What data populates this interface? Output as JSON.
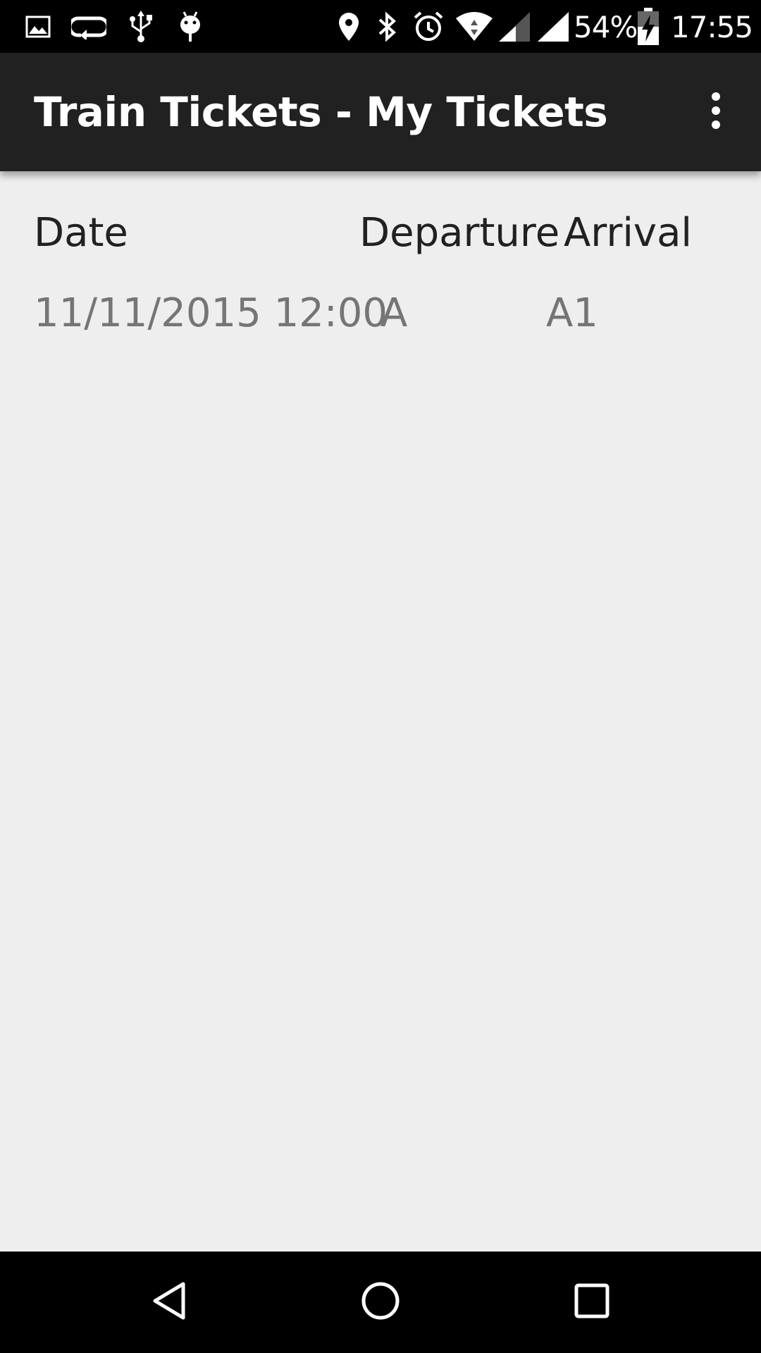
{
  "status_bar": {
    "battery_percent": "54%",
    "time": "17:55",
    "left_icons": [
      "image-icon",
      "loop-icon",
      "usb-icon",
      "android-debug-icon"
    ],
    "right_icons": [
      "location-icon",
      "bluetooth-icon",
      "alarm-icon",
      "wifi-icon",
      "signal-icon",
      "battery-charging-icon"
    ]
  },
  "app_bar": {
    "title": "Train Tickets - My Tickets",
    "overflow_icon": "more-vert-icon"
  },
  "table": {
    "headers": {
      "date": "Date",
      "departure": "Departure",
      "arrival": "Arrival"
    },
    "rows": [
      {
        "date": "11/11/2015 12:00",
        "departure": "A",
        "arrival": "A1"
      }
    ]
  },
  "nav_bar": {
    "icons": [
      "back-icon",
      "home-icon",
      "recents-icon"
    ]
  },
  "colors": {
    "status_bar": "#000000",
    "app_bar": "#212121",
    "background": "#eeeeee",
    "header_text": "#212121",
    "row_text": "#757575"
  }
}
